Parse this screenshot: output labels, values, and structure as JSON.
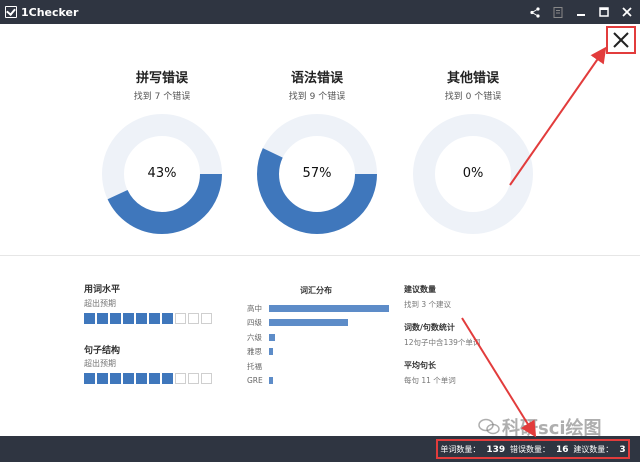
{
  "app": {
    "title": "1Checker"
  },
  "donuts": [
    {
      "title": "拼写错误",
      "subtitle": "找到 7 个错误",
      "percent": 0.43,
      "label": "43%"
    },
    {
      "title": "语法错误",
      "subtitle": "找到 9 个错误",
      "percent": 0.57,
      "label": "57%"
    },
    {
      "title": "其他错误",
      "subtitle": "找到 0 个错误",
      "percent": 0,
      "label": "0%"
    }
  ],
  "stats": {
    "vocab_level": {
      "label": "用词水平",
      "sub": "超出预期",
      "filled": 7,
      "total": 10
    },
    "sentence": {
      "label": "句子结构",
      "sub": "超出预期",
      "filled": 7,
      "total": 10
    }
  },
  "vocab_dist": {
    "title": "词汇分布",
    "rows": [
      {
        "label": "高中",
        "value": 1.0
      },
      {
        "label": "四级",
        "value": 0.66
      },
      {
        "label": "六级",
        "value": 0.05
      },
      {
        "label": "雅思",
        "value": 0.03
      },
      {
        "label": "托福",
        "value": 0.0
      },
      {
        "label": "GRE",
        "value": 0.03
      }
    ]
  },
  "right": {
    "suggest_label": "建议数量",
    "suggest_sub": "找到 3 个建议",
    "ratio_label": "词数/句数统计",
    "ratio_sub": "12句子中含139个单词",
    "avg_label": "平均句长",
    "avg_sub": "每句 11 个单词"
  },
  "status": {
    "words_label": "单词数量：",
    "words_value": "139",
    "errors_label": "错误数量：",
    "errors_value": "16",
    "suggest_label": "建议数量：",
    "suggest_value": "3"
  },
  "watermark": "科研sci绘图",
  "colors": {
    "accent": "#3f77bc",
    "track": "#eef2f8",
    "titlebar": "#2f3541",
    "annotation": "#e23c3c"
  }
}
